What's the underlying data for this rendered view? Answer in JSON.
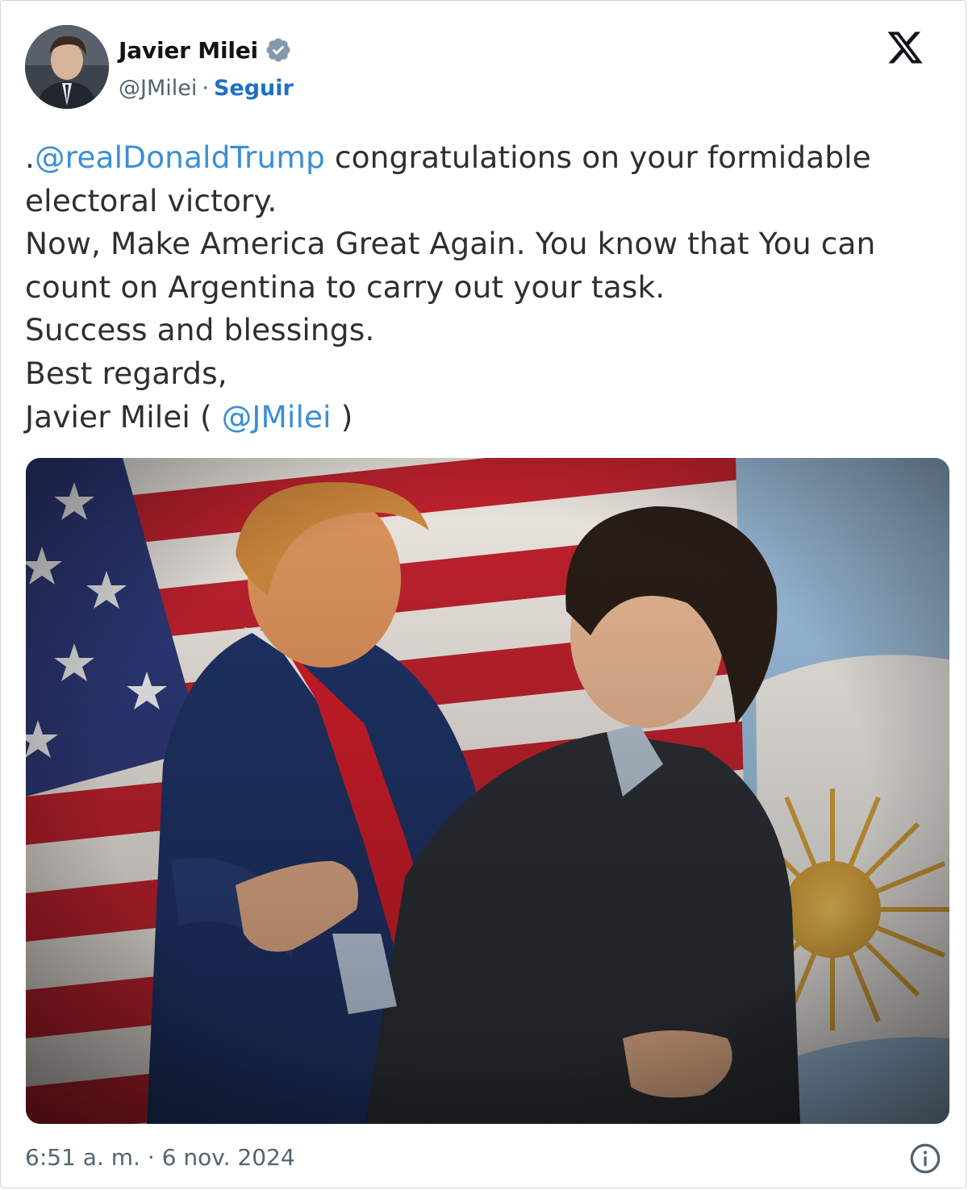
{
  "author": {
    "display_name": "Javier Milei",
    "handle": "@JMilei",
    "separator": "·",
    "follow_label": "Seguir",
    "verified_icon": "verified-badge-icon",
    "avatar_icon": "profile-photo"
  },
  "header": {
    "platform_logo": "x-logo-icon"
  },
  "tweet": {
    "line1_prefix": ".",
    "line1_mention": "@realDonaldTrump",
    "line1_rest": " congratulations on your formidable",
    "line2": "electoral victory.",
    "line3": "Now, Make America Great Again. You know that You can",
    "line4": "count on Argentina to carry out your task.",
    "line5": "Success and blessings.",
    "line6": "Best regards,",
    "line7_prefix": "Javier Milei ( ",
    "line7_mention": "@JMilei",
    "line7_suffix": " )"
  },
  "media": {
    "description_icon": "photo-two-men-embracing-before-us-and-argentina-flags"
  },
  "footer": {
    "timestamp": "6:51 a. m. · 6 nov. 2024",
    "info_icon": "info-icon"
  },
  "colors": {
    "link": "#3a8fd6",
    "follow": "#1d6fc9",
    "secondary_text": "#536471",
    "verified": "#829aab"
  }
}
